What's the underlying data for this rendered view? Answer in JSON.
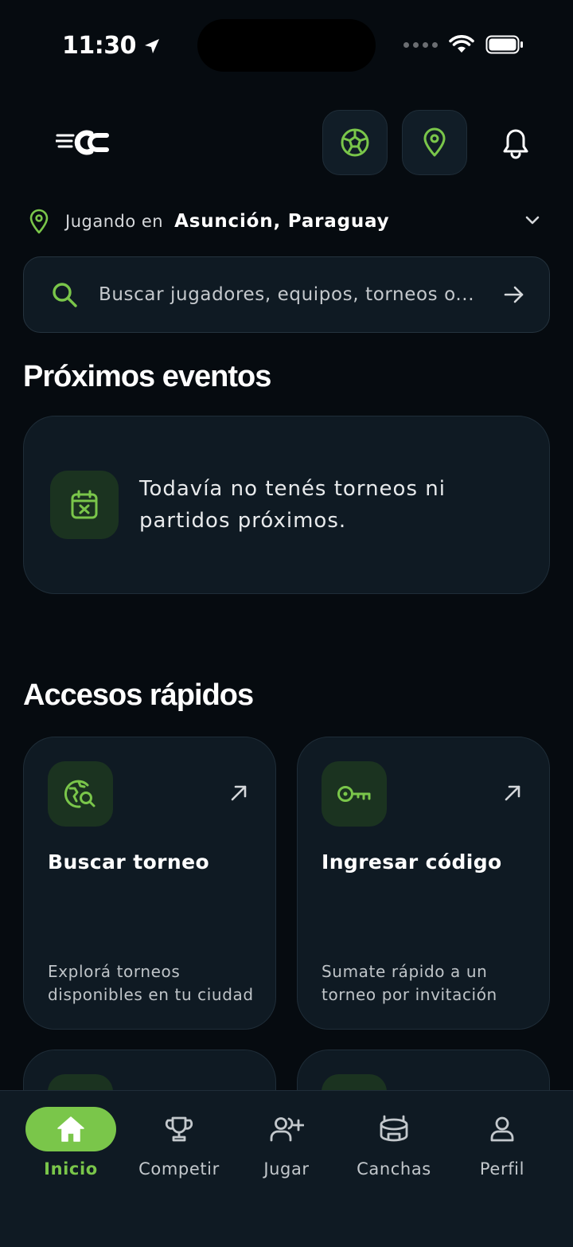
{
  "status_bar": {
    "time": "11:30"
  },
  "location": {
    "prefix": "Jugando en",
    "city": "Asunción, Paraguay"
  },
  "search": {
    "placeholder": "Buscar jugadores, equipos, torneos o..."
  },
  "upcoming": {
    "title": "Próximos eventos",
    "empty_message": "Todavía no tenés torneos ni partidos próximos."
  },
  "quick_access": {
    "title": "Accesos rápidos",
    "cards": [
      {
        "title": "Buscar torneo",
        "desc_line1": "Explorá torneos",
        "desc_line2": "disponibles en tu ciudad"
      },
      {
        "title": "Ingresar código",
        "desc_line1": "Sumate rápido a un",
        "desc_line2": "torneo por invitación"
      }
    ]
  },
  "tabs": [
    {
      "label": "Inicio",
      "icon": "home-icon",
      "active": true
    },
    {
      "label": "Competir",
      "icon": "trophy-icon",
      "active": false
    },
    {
      "label": "Jugar",
      "icon": "add-user-icon",
      "active": false
    },
    {
      "label": "Canchas",
      "icon": "stadium-icon",
      "active": false
    },
    {
      "label": "Perfil",
      "icon": "user-icon",
      "active": false
    }
  ],
  "colors": {
    "accent": "#7ac64a",
    "background": "#060b10",
    "card": "#0f1a23",
    "icon_tile": "#1b3320"
  }
}
